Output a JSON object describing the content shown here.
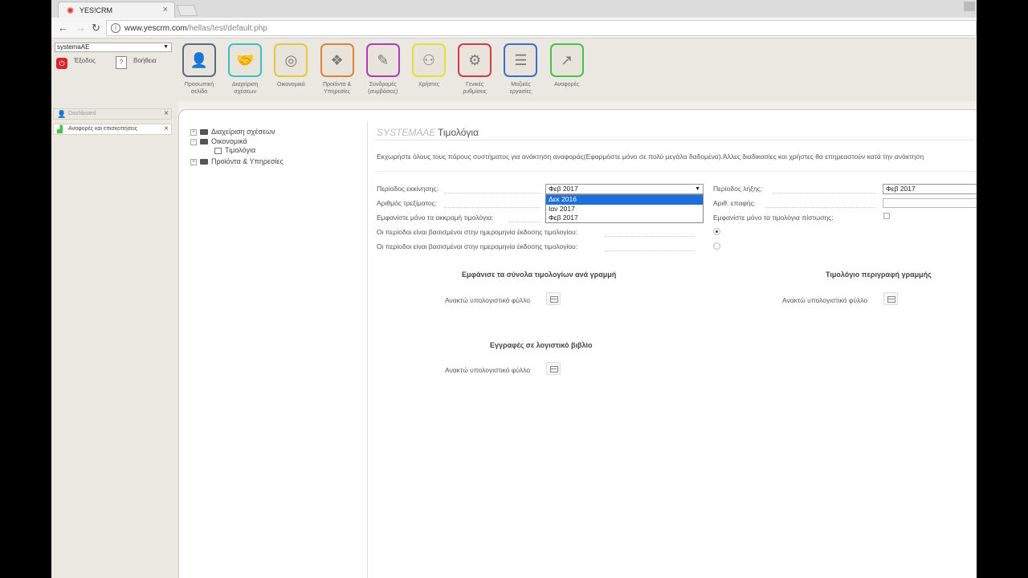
{
  "browser": {
    "tab_title": "YES!CRM",
    "tab_close": "×",
    "url_host": "www.yescrm.com",
    "url_path": "/hellas/test/default.php",
    "back": "←",
    "forward": "→",
    "reload": "↻"
  },
  "header": {
    "user": "systemaAE",
    "exit_label": "Έξοδος",
    "help_label": "Βοήθεια",
    "modules": [
      {
        "label": "Προσωπική σελίδα",
        "icon": "person-icon",
        "color": "#5a6b8c"
      },
      {
        "label": "Διαχείριση σχέσεων",
        "icon": "handshake-icon",
        "color": "#3ebfc4"
      },
      {
        "label": "Οικονομικά",
        "icon": "coins-icon",
        "color": "#e6c73a"
      },
      {
        "label": "Προϊόντα & Υπηρεσίες",
        "icon": "dropbox-icon",
        "color": "#e0823a"
      },
      {
        "label": "Συνδρομές (συμβάσεις)",
        "icon": "palette-icon",
        "color": "#b23bb7"
      },
      {
        "label": "Χρήστες",
        "icon": "users-icon",
        "color": "#e4e03a"
      },
      {
        "label": "Γενικές ρυθμίσεις",
        "icon": "gears-icon",
        "color": "#d03a4a"
      },
      {
        "label": "Μαζικές εργασίες",
        "icon": "stack-icon",
        "color": "#3a6fd0"
      },
      {
        "label": "Αναφορές",
        "icon": "chart-icon",
        "color": "#4ac24a"
      }
    ]
  },
  "sidebar": {
    "tabs": [
      {
        "label": "Dashboard",
        "active": false
      },
      {
        "label": "Αναφορές και επισκοπήσεις",
        "active": true
      }
    ],
    "close": "×"
  },
  "tree": {
    "items": [
      {
        "label": "Διαχείριση σχέσεων",
        "toggle": "+"
      },
      {
        "label": "Οικονομικά",
        "toggle": "−"
      },
      {
        "label": "Τιμολόγια",
        "toggle": ""
      },
      {
        "label": "Προϊόντα & Υπηρεσίες",
        "toggle": "+"
      }
    ]
  },
  "page": {
    "module": "SYSTEMAAE",
    "title": "Τιμολόγια",
    "description": "Εκχωρήστε όλους τους πόρους συστήματος για ανάκτηση αναφοράς(Εφαρμόστε μόνο σε πολύ μεγάλα δαδομένα).Άλλες διαδικασίες και χρήστες θα επηρεαστούν κατά την ανάκτηση"
  },
  "form": {
    "start_period_label": "Περίοδος εκκίνησης:",
    "start_period_value": "Φεβ 2017",
    "start_period_options": [
      "Δεκ 2016",
      "Ιαν 2017",
      "Φεβ 2017"
    ],
    "current_number_label": "Αριθμός τρεξίματος:",
    "show_extreme_label": "Εμφανίστε μόνο τα ακκραμή τιμολόγια:",
    "period_issue_label_1": "Οι περίοδοι είναι βασισμένοι στην ημερομηνία έκδοσης τιμολογίου:",
    "period_issue_label_2": "Οι περίοδοι είναι βασισμένοι στην ημερομηνία έκδοσης τιμολογίου:",
    "end_period_label": "Περίοδος λήξης:",
    "end_period_value": "Φεβ 2017",
    "contact_number_label": "Αριθ. επαφής:",
    "show_credit_label": "Εμφανίστε μόνο τα τιμολόγια πίστωσης:"
  },
  "sections": {
    "totals_title": "Εμφάνισε τα σύνολα τιμολογίων ανά γραμμή",
    "totals_sheet": "Ανακτώ υπολογιστικό φύλλο",
    "description_title": "Τιμολόγιο περιγραφή γραμμής",
    "description_sheet": "Ανακτώ υπολογιστικό φύλλο",
    "ledger_title": "Εγγραφές σε λογιστικό βιβλίο",
    "ledger_sheet": "Ανακτώ υπολογιστικό φύλλο"
  }
}
